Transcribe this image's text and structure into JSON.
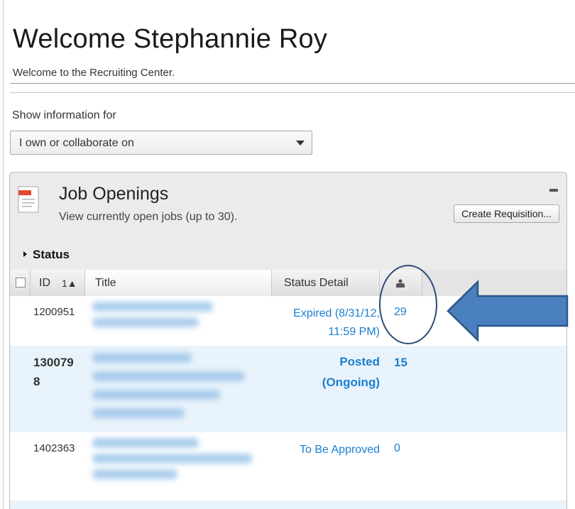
{
  "header": {
    "title": "Welcome Stephannie Roy",
    "subtitle": "Welcome to the Recruiting Center."
  },
  "filter": {
    "label": "Show information for",
    "selected": "I own or collaborate on"
  },
  "panel": {
    "title": "Job Openings",
    "subtitle": "View currently open jobs (up to 30).",
    "create_button": "Create Requisition...",
    "status_label": "Status"
  },
  "table": {
    "columns": {
      "id": "ID",
      "id_sort": "1▲",
      "title": "Title",
      "status": "Status Detail"
    },
    "rows": [
      {
        "id": "1200951",
        "status_line1": "Expired (8/31/12,",
        "status_line2": "11:59 PM)",
        "count": "29"
      },
      {
        "id_line1": "130079",
        "id_line2": "8",
        "status_line1": "Posted",
        "status_line2": "(Ongoing)",
        "count": "15"
      },
      {
        "id": "1402363",
        "status": "To Be Approved",
        "count": "0"
      }
    ]
  },
  "colors": {
    "link": "#1a7fd1",
    "annotation_arrow": "#4a7fc0",
    "annotation_outline": "#2a4a78",
    "alt_row": "#e9f3fb"
  }
}
